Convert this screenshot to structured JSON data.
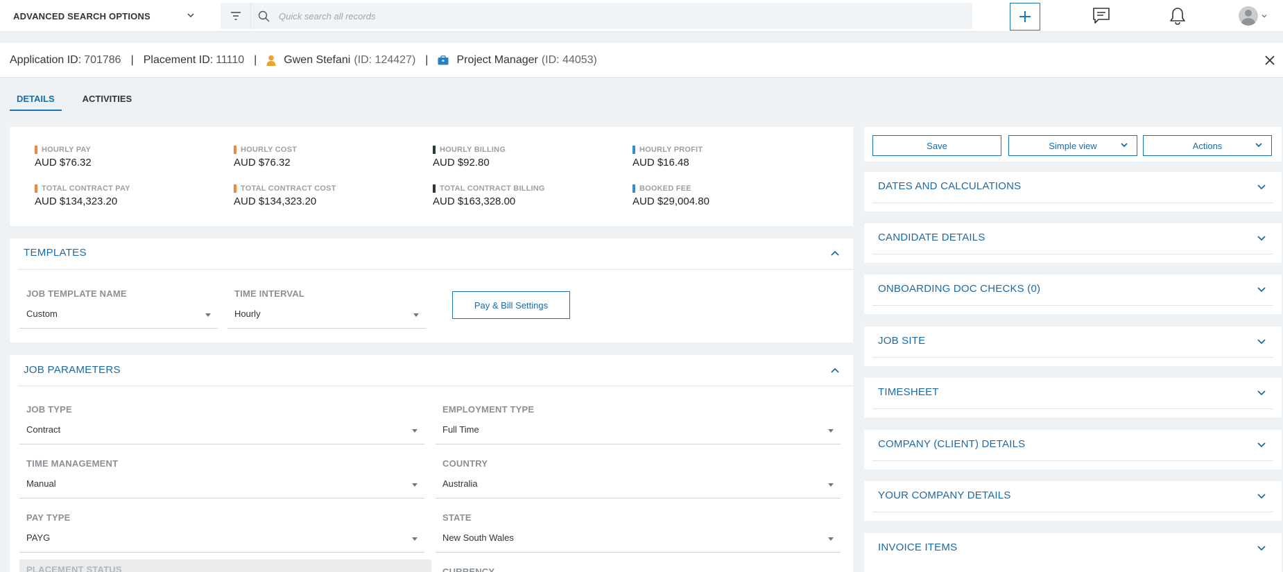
{
  "topbar": {
    "advanced_search_label": "ADVANCED SEARCH OPTIONS",
    "search_placeholder": "Quick search all records"
  },
  "header": {
    "application_id_label": "Application ID:",
    "application_id": "701786",
    "placement_id_label": "Placement ID:",
    "placement_id": "11110",
    "separator": "|",
    "candidate_name": "Gwen Stefani",
    "candidate_id": "(ID: 124427)",
    "job_title": "Project Manager",
    "job_id": "(ID: 44053)"
  },
  "tabs": [
    {
      "label": "DETAILS",
      "active": true
    },
    {
      "label": "ACTIVITIES",
      "active": false
    }
  ],
  "stats": [
    {
      "label": "HOURLY PAY",
      "value": "AUD $76.32",
      "color": "#f0883a"
    },
    {
      "label": "HOURLY COST",
      "value": "AUD $76.32",
      "color": "#f0883a"
    },
    {
      "label": "HOURLY BILLING",
      "value": "AUD $92.80",
      "color": "#2b3a2f"
    },
    {
      "label": "HOURLY PROFIT",
      "value": "AUD $16.48",
      "color": "#2f8fcf"
    },
    {
      "label": "TOTAL CONTRACT PAY",
      "value": "AUD $134,323.20",
      "color": "#f0883a"
    },
    {
      "label": "TOTAL CONTRACT COST",
      "value": "AUD $134,323.20",
      "color": "#f0883a"
    },
    {
      "label": "TOTAL CONTRACT BILLING",
      "value": "AUD $163,328.00",
      "color": "#2b3a2f"
    },
    {
      "label": "BOOKED FEE",
      "value": "AUD $29,004.80",
      "color": "#2f8fcf"
    }
  ],
  "templates": {
    "title": "TEMPLATES",
    "job_template_label": "JOB TEMPLATE NAME",
    "job_template_value": "Custom",
    "time_interval_label": "TIME INTERVAL",
    "time_interval_value": "Hourly",
    "pay_bill_button": "Pay & Bill Settings"
  },
  "job_parameters": {
    "title": "JOB PARAMETERS",
    "fields": [
      {
        "label": "JOB TYPE",
        "value": "Contract"
      },
      {
        "label": "EMPLOYMENT TYPE",
        "value": "Full Time"
      },
      {
        "label": "TIME MANAGEMENT",
        "value": "Manual"
      },
      {
        "label": "COUNTRY",
        "value": "Australia"
      },
      {
        "label": "PAY TYPE",
        "value": "PAYG"
      },
      {
        "label": "STATE",
        "value": "New South Wales"
      },
      {
        "label": "PLACEMENT STATUS",
        "value": ""
      },
      {
        "label": "CURRENCY",
        "value": ""
      }
    ]
  },
  "right_panel": {
    "save_label": "Save",
    "simple_view_label": "Simple view",
    "actions_label": "Actions",
    "sections": [
      "DATES AND CALCULATIONS",
      "CANDIDATE DETAILS",
      "ONBOARDING DOC CHECKS (0)",
      "JOB SITE",
      "TIMESHEET",
      "COMPANY (CLIENT) DETAILS",
      "YOUR COMPANY DETAILS",
      "INVOICE ITEMS"
    ]
  },
  "colors": {
    "accent": "#1b75bb",
    "candidate_icon": "#f0a030",
    "job_icon": "#2a7fc0"
  }
}
